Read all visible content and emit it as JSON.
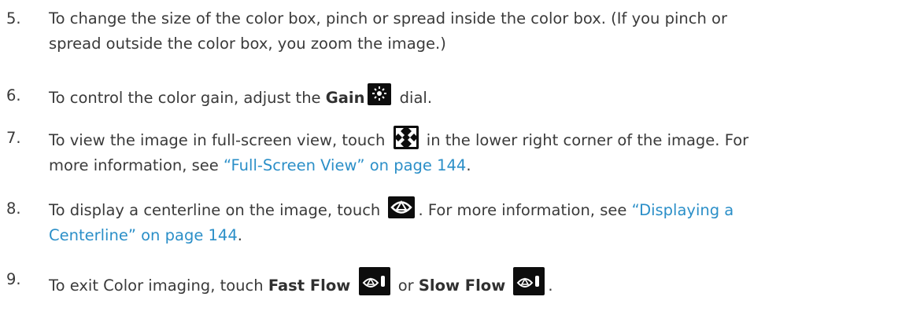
{
  "steps": [
    {
      "number": "5.",
      "line1": "To change the size of the color box, pinch or spread inside the color box. (If you pinch or",
      "line2": "spread outside the color box, you zoom the image.)"
    },
    {
      "number": "6.",
      "pre": "To control the color gain, adjust the ",
      "bold": "Gain",
      "post": " dial.",
      "icon": "gain-sun-icon"
    },
    {
      "number": "7.",
      "pre": "To view the image in full-screen view, touch ",
      "post": " in the lower right corner of the image. For",
      "line2_pre": "more information, see ",
      "line2_link": "“Full-Screen View” on page 144",
      "line2_post": ".",
      "icon": "fullscreen-arrows-icon"
    },
    {
      "number": "8.",
      "pre": "To display a centerline on the image, touch ",
      "post": ". For more information, see ",
      "link1": "“Displaying a",
      "line2_link": "Centerline” on page 144",
      "line2_post": ".",
      "icon": "centerline-icon"
    },
    {
      "number": "9.",
      "pre": "To exit Color imaging, touch ",
      "bold1": "Fast Flow",
      "mid": " or ",
      "bold2": "Slow Flow",
      "post": ".",
      "icon": "flow-icon"
    }
  ],
  "colors": {
    "text": "#3a3a3a",
    "link": "#2b8fc8",
    "icon_bg": "#0d0d0d"
  }
}
